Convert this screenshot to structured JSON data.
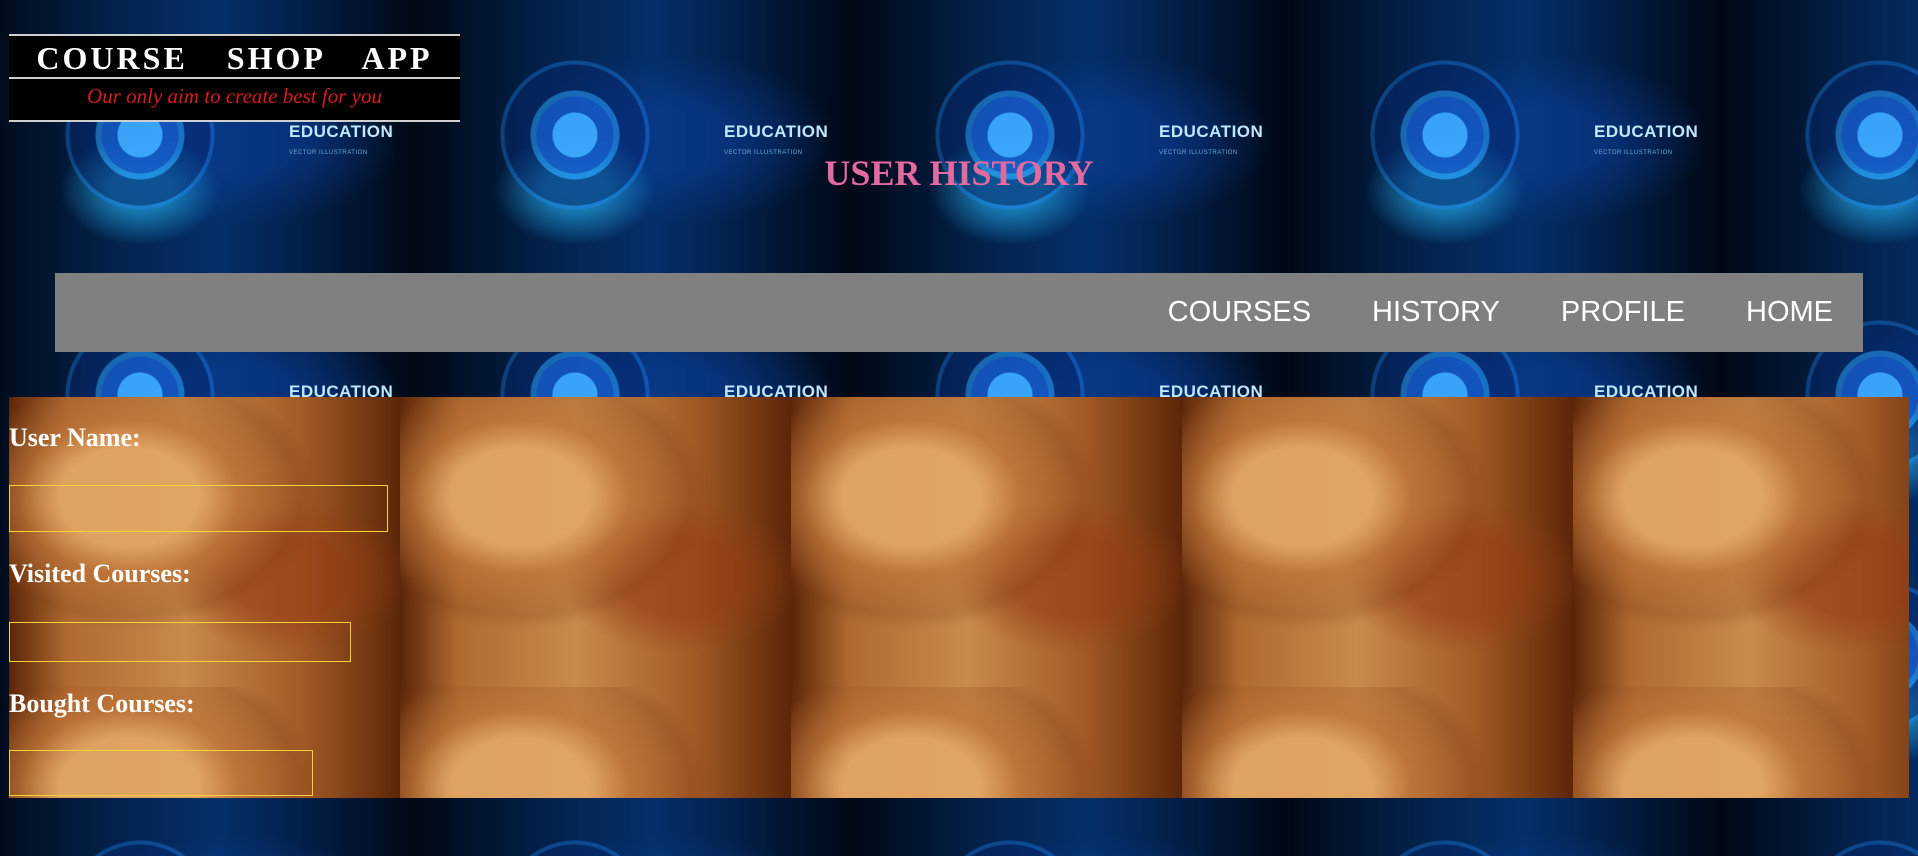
{
  "logo": {
    "title": "COURSE SHOP APP",
    "tagline": "Our only aim to create best for you"
  },
  "background": {
    "tile_label": "EDUCATION",
    "tile_sublabel": "VECTOR ILLUSTRATION",
    "colors": {
      "deep": "#02122b",
      "glow": "#3caaff"
    }
  },
  "heading": "USER HISTORY",
  "nav": {
    "items": [
      {
        "label": "COURSES"
      },
      {
        "label": "HISTORY"
      },
      {
        "label": "PROFILE"
      },
      {
        "label": "HOME"
      }
    ],
    "background": "#808080"
  },
  "form": {
    "user_name_label": "User Name:",
    "user_name_value": "",
    "visited_label": "Visited Courses:",
    "visited_value": "",
    "bought_label": "Bought Courses:",
    "bought_value": "",
    "input_border_color": "#f2d43a"
  }
}
